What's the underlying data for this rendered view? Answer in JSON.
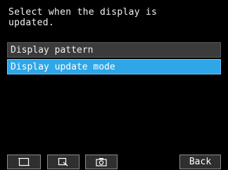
{
  "screen": {
    "prompt": "Select when the display is\nupdated."
  },
  "menu": {
    "items": [
      {
        "label": "Display pattern",
        "selected": false
      },
      {
        "label": "Display update mode",
        "selected": true
      }
    ]
  },
  "toolbar": {
    "icons": [
      "frame-icon",
      "zoom-icon",
      "camera-icon"
    ],
    "back_label": "Back"
  },
  "colors": {
    "background": "#000000",
    "menu_item": "#3b3b3b",
    "selected_item": "#2ea6e7",
    "button_border": "#8b8b8b"
  }
}
